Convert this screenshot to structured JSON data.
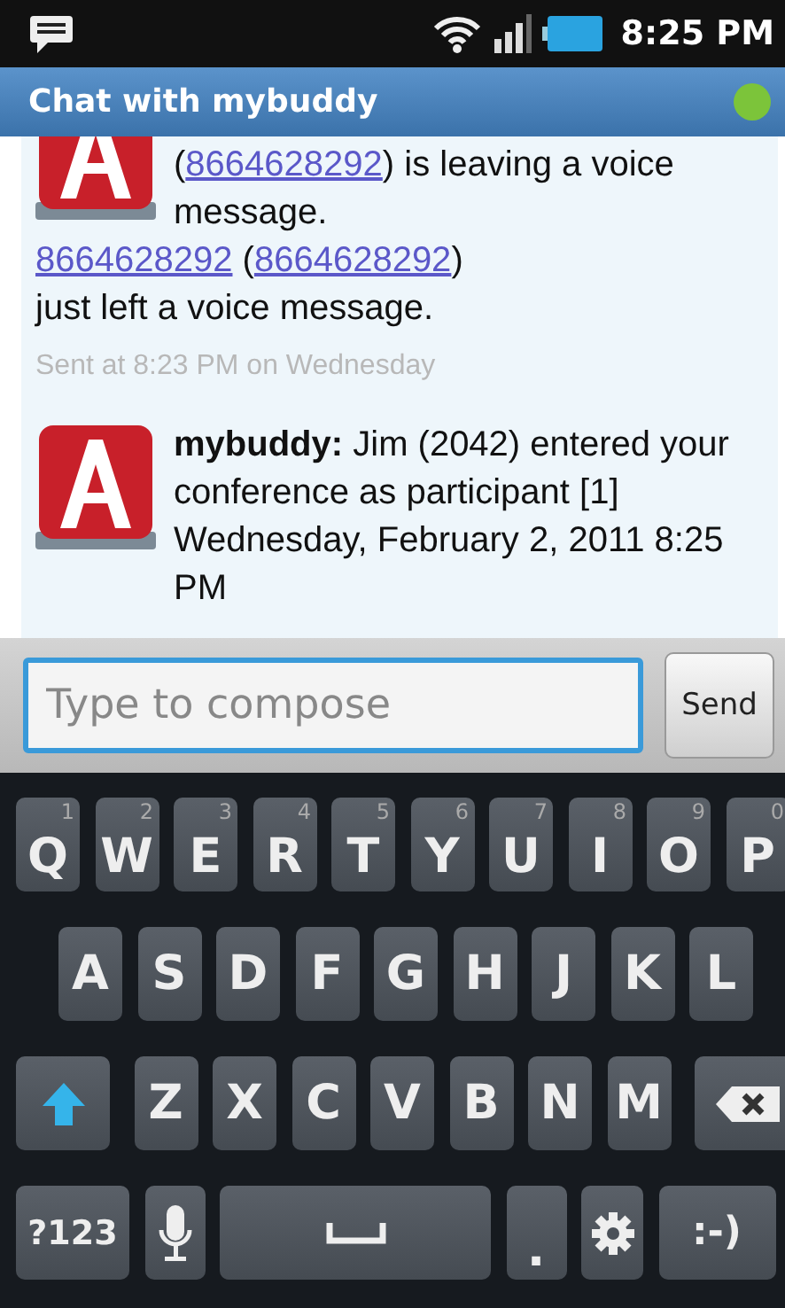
{
  "status_bar": {
    "time": "8:25 PM"
  },
  "title_bar": {
    "title": "Chat with mybuddy",
    "online": true
  },
  "messages": [
    {
      "paragraphs": [
        [
          {
            "kind": "text",
            "text": "("
          },
          {
            "kind": "link",
            "text": "8664628292"
          },
          {
            "kind": "text",
            "text": ") is leaving a voice message."
          }
        ],
        [
          {
            "kind": "link",
            "text": "8664628292"
          },
          {
            "kind": "text",
            "text": " ("
          },
          {
            "kind": "link",
            "text": "8664628292"
          },
          {
            "kind": "text",
            "text": ")"
          }
        ],
        [
          {
            "kind": "text",
            "text": "just left a voice message."
          }
        ]
      ],
      "sent": "Sent at 8:23 PM on Wednesday"
    },
    {
      "paragraphs": [
        [
          {
            "kind": "bold",
            "text": "mybuddy:"
          },
          {
            "kind": "text",
            "text": "  Jim (2042) entered your conference as participant [1] Wednesday, February 2, 2011 8:25 PM"
          }
        ]
      ]
    }
  ],
  "compose": {
    "placeholder": "Type to compose",
    "button": "Send"
  },
  "keyboard": [
    [
      {
        "kind": "letter",
        "label": "Q",
        "hint": "1"
      },
      {
        "kind": "letter",
        "label": "W",
        "hint": "2"
      },
      {
        "kind": "letter",
        "label": "E",
        "hint": "3"
      },
      {
        "kind": "letter",
        "label": "R",
        "hint": "4"
      },
      {
        "kind": "letter",
        "label": "T",
        "hint": "5"
      },
      {
        "kind": "letter",
        "label": "Y",
        "hint": "6"
      },
      {
        "kind": "letter",
        "label": "U",
        "hint": "7"
      },
      {
        "kind": "letter",
        "label": "I",
        "hint": "8"
      },
      {
        "kind": "letter",
        "label": "O",
        "hint": "9"
      },
      {
        "kind": "letter",
        "label": "P",
        "hint": "0"
      }
    ],
    [
      {
        "kind": "letter",
        "label": "A"
      },
      {
        "kind": "letter",
        "label": "S"
      },
      {
        "kind": "letter",
        "label": "D"
      },
      {
        "kind": "letter",
        "label": "F"
      },
      {
        "kind": "letter",
        "label": "G"
      },
      {
        "kind": "letter",
        "label": "H"
      },
      {
        "kind": "letter",
        "label": "J"
      },
      {
        "kind": "letter",
        "label": "K"
      },
      {
        "kind": "letter",
        "label": "L"
      }
    ],
    [
      {
        "kind": "shift"
      },
      {
        "kind": "letter",
        "label": "Z"
      },
      {
        "kind": "letter",
        "label": "X"
      },
      {
        "kind": "letter",
        "label": "C"
      },
      {
        "kind": "letter",
        "label": "V"
      },
      {
        "kind": "letter",
        "label": "B"
      },
      {
        "kind": "letter",
        "label": "N"
      },
      {
        "kind": "letter",
        "label": "M"
      },
      {
        "kind": "backspace"
      }
    ],
    [
      {
        "kind": "wide",
        "label": "?123"
      },
      {
        "kind": "mic"
      },
      {
        "kind": "space"
      },
      {
        "kind": "small",
        "label": "."
      },
      {
        "kind": "settings"
      },
      {
        "kind": "wide",
        "label": ":-)"
      }
    ]
  ]
}
